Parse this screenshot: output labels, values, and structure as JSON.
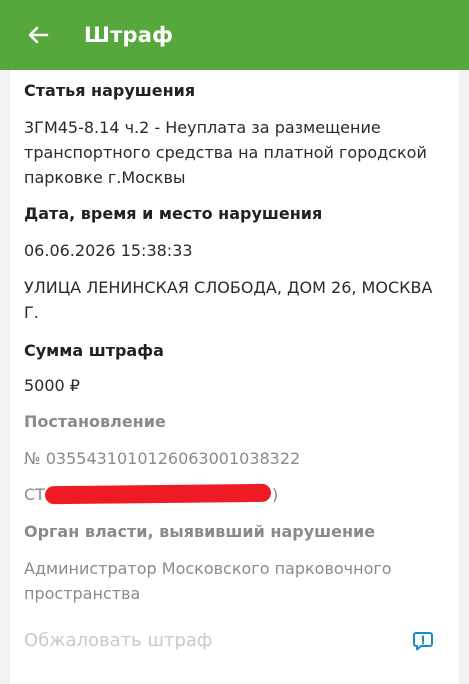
{
  "header": {
    "title": "Штраф",
    "back_icon": "arrow-left-icon",
    "color": "#56a83c"
  },
  "violation": {
    "article_label": "Статья нарушения",
    "article_value": "3ГМ45-8.14 ч.2 - Неуплата за размещение транспортного средства на платной городской парковке г.Москвы",
    "datetime_place_label": "Дата, время и место нарушения",
    "datetime_value": "06.06.2026 15:38:33",
    "place_value": "УЛИЦА ЛЕНИНСКАЯ СЛОБОДА, ДОМ 26, МОСКВА Г.",
    "amount_label": "Сумма штрафа",
    "amount_value": "5000 ₽"
  },
  "resolution": {
    "label": "Постановление",
    "number": "№ 0355431010126063001038322",
    "sts_prefix": "СТС",
    "sts_suffix": ")"
  },
  "authority": {
    "label": "Орган власти, выявивший нарушение",
    "value": "Администратор Московского парковочного пространства"
  },
  "actions": {
    "appeal_label": "Обжаловать штраф",
    "report_icon": "feedback-icon",
    "accent_color": "#1e88c8"
  }
}
